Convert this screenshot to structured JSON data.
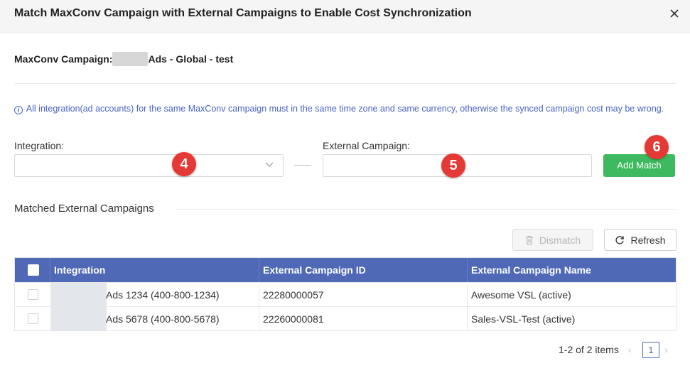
{
  "dialog": {
    "title": "Match MaxConv Campaign with External Campaigns to Enable Cost Synchronization"
  },
  "campaign": {
    "label": "MaxConv Campaign:",
    "name_suffix": "Ads - Global - test"
  },
  "notice": {
    "text": "All integration(ad accounts) for the same MaxConv campaign must in the same time zone and same currency, otherwise the synced campaign cost may be wrong."
  },
  "form": {
    "integration_label": "Integration:",
    "integration_value": "",
    "external_label": "External Campaign:",
    "external_value": "",
    "add_button": "Add Match"
  },
  "markers": [
    "4",
    "5",
    "6"
  ],
  "matched": {
    "section_title": "Matched External Campaigns",
    "dismatch_button": "Dismatch",
    "refresh_button": "Refresh",
    "columns": [
      "Integration",
      "External Campaign ID",
      "External Campaign Name"
    ],
    "rows": [
      {
        "integration": "Ads 1234 (400-800-1234)",
        "campaign_id": "22280000057",
        "campaign_name": "Awesome VSL (active)"
      },
      {
        "integration": "Ads 5678 (400-800-5678)",
        "campaign_id": "22260000081",
        "campaign_name": "Sales-VSL-Test (active)"
      }
    ]
  },
  "pagination": {
    "summary": "1-2 of 2 items",
    "current_page": "1"
  },
  "colors": {
    "primary": "#5069b7",
    "success": "#3fb95f",
    "marker": "#e53935",
    "notice": "#4a63c4"
  }
}
